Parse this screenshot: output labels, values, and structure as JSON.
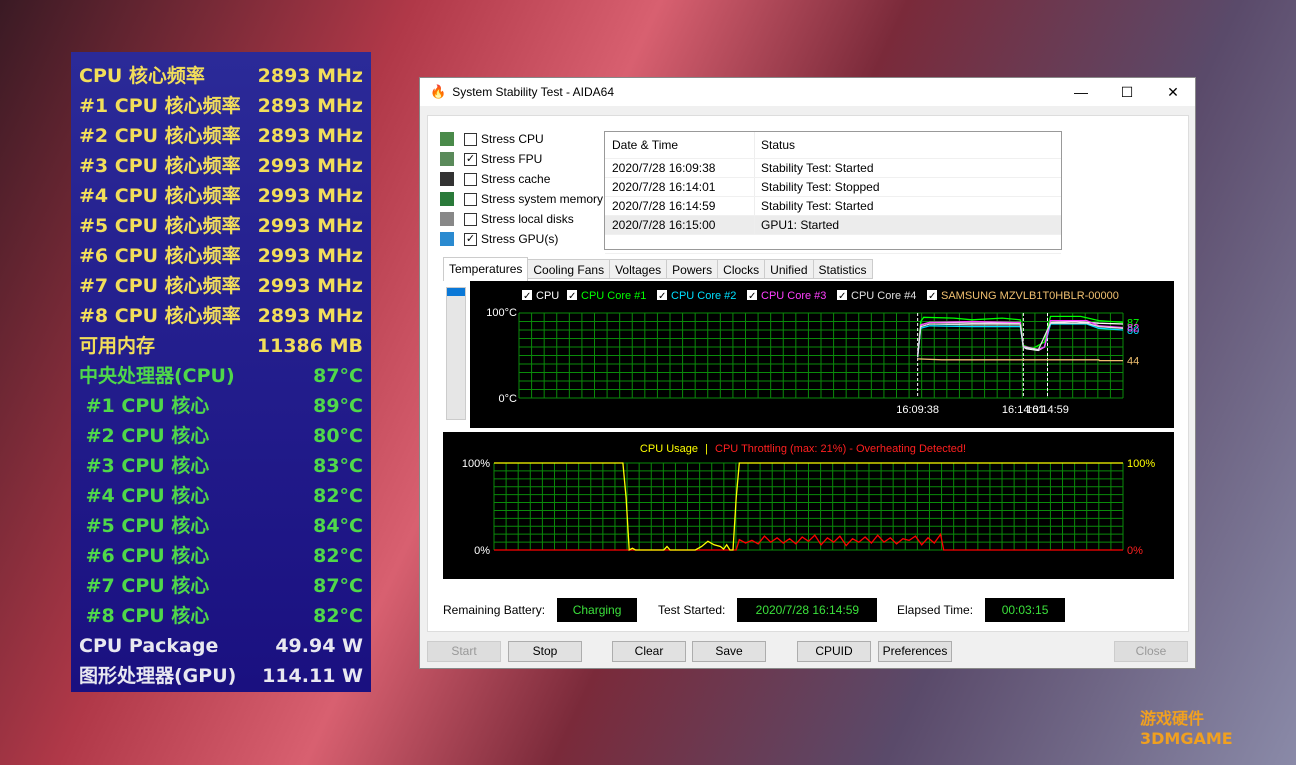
{
  "overlay": {
    "rows": [
      {
        "label": "CPU 核心频率",
        "value": "2893 MHz",
        "color": "y"
      },
      {
        "label": "#1 CPU 核心频率",
        "value": "2893 MHz",
        "color": "y"
      },
      {
        "label": "#2 CPU 核心频率",
        "value": "2893 MHz",
        "color": "y"
      },
      {
        "label": "#3 CPU 核心频率",
        "value": "2993 MHz",
        "color": "y"
      },
      {
        "label": "#4 CPU 核心频率",
        "value": "2993 MHz",
        "color": "y"
      },
      {
        "label": "#5 CPU 核心频率",
        "value": "2993 MHz",
        "color": "y"
      },
      {
        "label": "#6 CPU 核心频率",
        "value": "2993 MHz",
        "color": "y"
      },
      {
        "label": "#7 CPU 核心频率",
        "value": "2993 MHz",
        "color": "y"
      },
      {
        "label": "#8 CPU 核心频率",
        "value": "2893 MHz",
        "color": "y"
      },
      {
        "label": "可用内存",
        "value": "11386 MB",
        "color": "y"
      },
      {
        "label": "中央处理器(CPU)",
        "value": "87°C",
        "color": "g"
      },
      {
        "label": " #1 CPU 核心",
        "value": "89°C",
        "color": "g"
      },
      {
        "label": " #2 CPU 核心",
        "value": "80°C",
        "color": "g"
      },
      {
        "label": " #3 CPU 核心",
        "value": "83°C",
        "color": "g"
      },
      {
        "label": " #4 CPU 核心",
        "value": "82°C",
        "color": "g"
      },
      {
        "label": " #5 CPU 核心",
        "value": "84°C",
        "color": "g"
      },
      {
        "label": " #6 CPU 核心",
        "value": "82°C",
        "color": "g"
      },
      {
        "label": " #7 CPU 核心",
        "value": "87°C",
        "color": "g"
      },
      {
        "label": " #8 CPU 核心",
        "value": "82°C",
        "color": "g"
      },
      {
        "label": "CPU Package",
        "value": "49.94 W",
        "color": "w"
      },
      {
        "label": "图形处理器(GPU)",
        "value": "114.11 W",
        "color": "w"
      }
    ]
  },
  "window": {
    "title": "System Stability Test - AIDA64",
    "minimize": "—",
    "maximize": "☐",
    "close": "✕"
  },
  "options": [
    {
      "label": "Stress CPU",
      "checked": false,
      "icon": "cpu-icon"
    },
    {
      "label": "Stress FPU",
      "checked": true,
      "icon": "fpu-icon"
    },
    {
      "label": "Stress cache",
      "checked": false,
      "icon": "cache-icon"
    },
    {
      "label": "Stress system memory",
      "checked": false,
      "icon": "memory-icon"
    },
    {
      "label": "Stress local disks",
      "checked": false,
      "icon": "disk-icon"
    },
    {
      "label": "Stress GPU(s)",
      "checked": true,
      "icon": "gpu-icon"
    }
  ],
  "log": {
    "headers": [
      "Date & Time",
      "Status"
    ],
    "rows": [
      [
        "2020/7/28 16:09:38",
        "Stability Test: Started"
      ],
      [
        "2020/7/28 16:14:01",
        "Stability Test: Stopped"
      ],
      [
        "2020/7/28 16:14:59",
        "Stability Test: Started"
      ],
      [
        "2020/7/28 16:15:00",
        "GPU1: Started"
      ]
    ]
  },
  "tabs": [
    "Temperatures",
    "Cooling Fans",
    "Voltages",
    "Powers",
    "Clocks",
    "Unified",
    "Statistics"
  ],
  "chart_data": [
    {
      "type": "line",
      "title": "Temperatures",
      "ylim": [
        0,
        100
      ],
      "ytick_top": "100°C",
      "ytick_bottom": "0°C",
      "x_labels": [
        {
          "text": "16:09:38",
          "sample": 66
        },
        {
          "text": "16:14:01",
          "sample": 83.5
        },
        {
          "text": "16:14:59",
          "sample": 87.5
        }
      ],
      "series": [
        {
          "name": "CPU",
          "color": "#ffffff",
          "values": [
            [
              66,
              48
            ],
            [
              66.5,
              86
            ],
            [
              68,
              89
            ],
            [
              75,
              88
            ],
            [
              83,
              88
            ],
            [
              83.5,
              60
            ],
            [
              84,
              58
            ],
            [
              86,
              56
            ],
            [
              87,
              60
            ],
            [
              88,
              89
            ],
            [
              92,
              90
            ],
            [
              96,
              88
            ],
            [
              100,
              87
            ]
          ],
          "end_label": ""
        },
        {
          "name": "CPU Core #1",
          "color": "#00ff00",
          "values": [
            [
              66,
              50
            ],
            [
              66.5,
              90
            ],
            [
              67,
              95
            ],
            [
              72,
              94
            ],
            [
              75,
              92
            ],
            [
              80,
              94
            ],
            [
              83,
              92
            ],
            [
              83.5,
              62
            ],
            [
              85,
              58
            ],
            [
              87,
              66
            ],
            [
              88,
              96
            ],
            [
              93,
              96
            ],
            [
              96,
              91
            ],
            [
              100,
              89
            ]
          ],
          "end_label": "87"
        },
        {
          "name": "CPU Core #2",
          "color": "#00e0ff",
          "values": [
            [
              66,
              48
            ],
            [
              66.5,
              82
            ],
            [
              68,
              85
            ],
            [
              75,
              84
            ],
            [
              83,
              84
            ],
            [
              83.5,
              60
            ],
            [
              86,
              57
            ],
            [
              87,
              60
            ],
            [
              88,
              87
            ],
            [
              94,
              87
            ],
            [
              96,
              82
            ],
            [
              100,
              80
            ]
          ],
          "end_label": "80"
        },
        {
          "name": "CPU Core #3",
          "color": "#ff40ff",
          "values": [
            [
              66,
              50
            ],
            [
              66.5,
              86
            ],
            [
              68,
              89
            ],
            [
              75,
              90
            ],
            [
              83,
              89
            ],
            [
              83.5,
              61
            ],
            [
              86,
              57
            ],
            [
              87,
              60
            ],
            [
              88,
              91
            ],
            [
              94,
              91
            ],
            [
              96,
              85
            ],
            [
              100,
              83
            ]
          ],
          "end_label": "82"
        },
        {
          "name": "CPU Core #4",
          "color": "#e0e0e0",
          "values": [
            [
              66,
              48
            ],
            [
              66.5,
              84
            ],
            [
              68,
              87
            ],
            [
              75,
              86
            ],
            [
              83,
              86
            ],
            [
              83.5,
              60
            ],
            [
              86,
              57
            ],
            [
              88,
              88
            ],
            [
              94,
              88
            ],
            [
              96,
              84
            ],
            [
              100,
              82
            ]
          ],
          "end_label": ""
        },
        {
          "name": "SAMSUNG MZVLB1T0HBLR-00000",
          "color": "#f0c070",
          "values": [
            [
              66,
              46
            ],
            [
              70,
              45
            ],
            [
              96,
              45
            ],
            [
              96.1,
              44
            ],
            [
              100,
              44
            ]
          ],
          "end_label": "44"
        }
      ]
    },
    {
      "type": "line",
      "title": "CPU Usage",
      "title2": "CPU Throttling (max: 21%) - Overheating Detected!",
      "ylim": [
        0,
        100
      ],
      "ytick_top": "100%",
      "ytick_bottom": "0%",
      "series": [
        {
          "name": "CPU Usage",
          "color": "#ffff00",
          "values": [
            [
              0,
              100
            ],
            [
              20.5,
              100
            ],
            [
              21,
              60
            ],
            [
              21.5,
              0
            ],
            [
              22,
              2
            ],
            [
              22.5,
              0
            ],
            [
              27,
              0
            ],
            [
              27.5,
              4
            ],
            [
              28,
              0
            ],
            [
              32,
              0
            ],
            [
              33,
              4
            ],
            [
              34,
              10
            ],
            [
              35,
              6
            ],
            [
              36,
              4
            ],
            [
              36.5,
              1
            ],
            [
              37,
              6
            ],
            [
              37.5,
              0
            ],
            [
              38,
              0
            ],
            [
              38.5,
              60
            ],
            [
              39,
              100
            ],
            [
              100,
              100
            ]
          ]
        },
        {
          "name": "CPU Throttling",
          "color": "#ff0000",
          "values": [
            [
              0,
              0
            ],
            [
              38.5,
              0
            ],
            [
              39,
              12
            ],
            [
              40,
              8
            ],
            [
              41,
              11
            ],
            [
              42,
              7
            ],
            [
              43,
              16
            ],
            [
              44,
              9
            ],
            [
              45,
              14
            ],
            [
              46,
              8
            ],
            [
              47,
              13
            ],
            [
              48,
              7
            ],
            [
              49,
              15
            ],
            [
              50,
              10
            ],
            [
              51,
              17
            ],
            [
              52,
              6
            ],
            [
              53,
              14
            ],
            [
              54,
              9
            ],
            [
              55,
              16
            ],
            [
              56,
              5
            ],
            [
              57,
              13
            ],
            [
              58,
              9
            ],
            [
              59,
              15
            ],
            [
              60,
              8
            ],
            [
              61,
              17
            ],
            [
              62,
              9
            ],
            [
              63,
              14
            ],
            [
              64,
              7
            ],
            [
              65,
              13
            ],
            [
              66,
              11
            ],
            [
              67,
              16
            ],
            [
              68,
              6
            ],
            [
              69,
              14
            ],
            [
              70,
              8
            ],
            [
              71,
              18
            ],
            [
              71.5,
              0
            ],
            [
              100,
              0
            ]
          ]
        }
      ]
    }
  ],
  "status": {
    "battery_label": "Remaining Battery:",
    "battery": "Charging",
    "started_label": "Test Started:",
    "started": "2020/7/28 16:14:59",
    "elapsed_label": "Elapsed Time:",
    "elapsed": "00:03:15"
  },
  "buttons": {
    "start": "Start",
    "stop": "Stop",
    "clear": "Clear",
    "save": "Save",
    "cpuid": "CPUID",
    "preferences": "Preferences",
    "close": "Close"
  },
  "watermark": "游戏硬件 3DMGAME"
}
